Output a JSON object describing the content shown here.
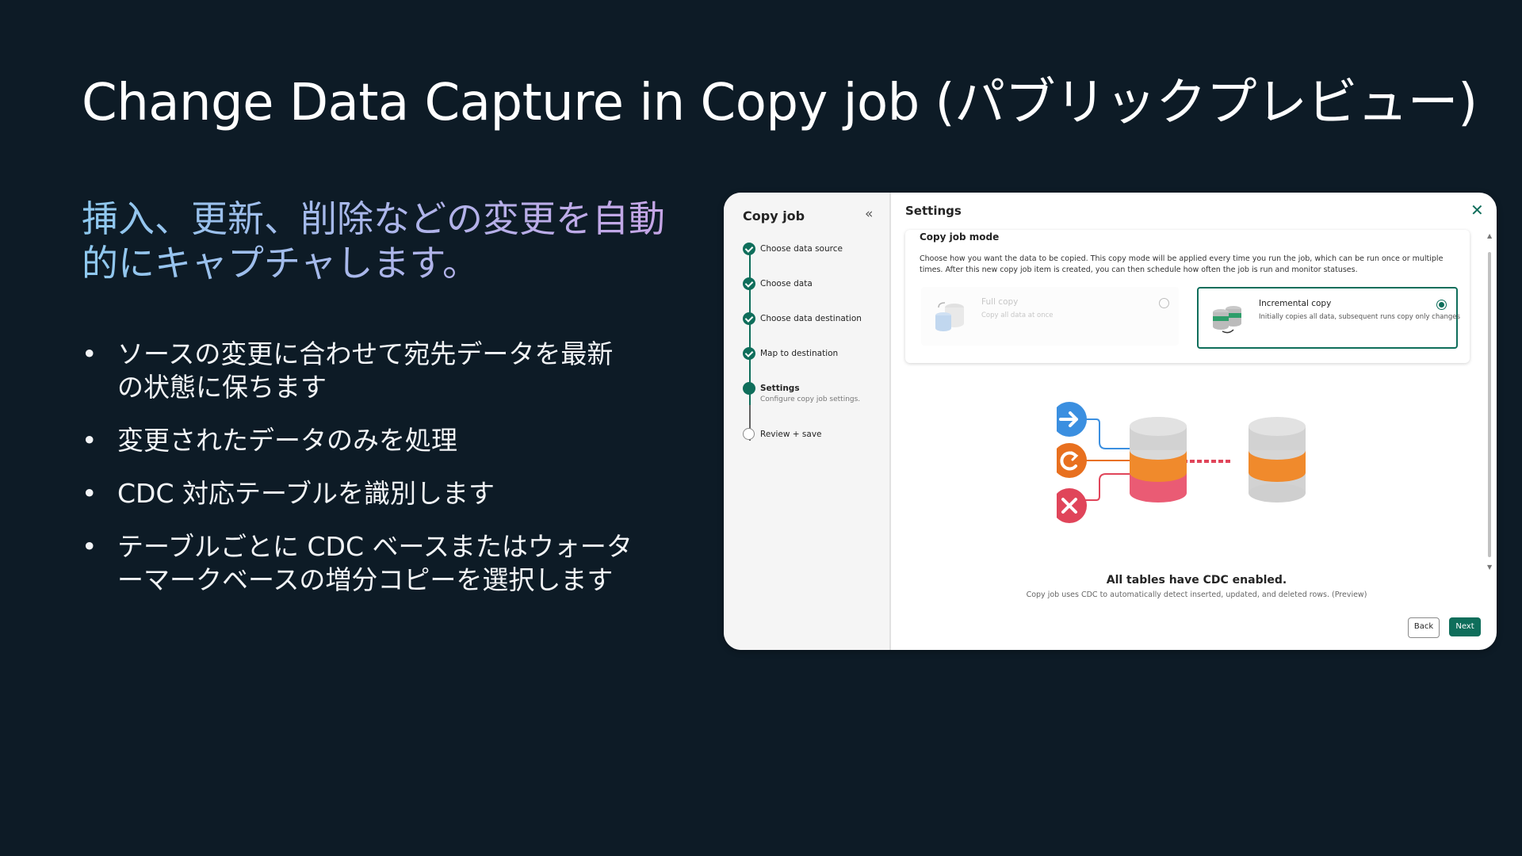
{
  "slide": {
    "title": "Change Data Capture in Copy job (パブリックプレビュー)",
    "headline": "挿入、更新、削除などの変更を自動的にキャプチャします。",
    "bullet_glyph": "•",
    "bullets": [
      "ソースの変更に合わせて宛先データを最新の状態に保ちます",
      "変更されたデータのみを処理",
      "CDC 対応テーブルを識別します",
      "テーブルごとに CDC ベースまたはウォーターマークベースの増分コピーを選択します"
    ]
  },
  "app": {
    "sidebar": {
      "title": "Copy job",
      "collapse": "«",
      "steps": [
        {
          "label": "Choose data source",
          "state": "done"
        },
        {
          "label": "Choose data",
          "state": "done"
        },
        {
          "label": "Choose data destination",
          "state": "done"
        },
        {
          "label": "Map to destination",
          "state": "done"
        },
        {
          "label": "Settings",
          "sub": "Configure copy job settings.",
          "state": "current"
        },
        {
          "label": "Review + save",
          "state": "pending"
        }
      ]
    },
    "main": {
      "title": "Settings",
      "close": "✕",
      "mode": {
        "title": "Copy job mode",
        "description": "Choose how you want the data to be copied. This copy mode will be applied every time you run the job, which can be run once or multiple times. After this new copy job item is created, you can then schedule how often the job is run and monitor statuses.",
        "options": [
          {
            "title": "Full copy",
            "description": "Copy all data at once",
            "selected": false
          },
          {
            "title": "Incremental copy",
            "description": "Initially copies all data, subsequent runs copy only changes",
            "selected": true
          }
        ]
      },
      "cdc_title": "All tables have CDC enabled.",
      "cdc_description": "Copy job uses CDC to automatically detect inserted, updated, and deleted rows. (Preview)",
      "back_label": "Back",
      "next_label": "Next",
      "scroll_up": "▲",
      "scroll_down": "▼"
    }
  },
  "colors": {
    "background": "#0d1b26",
    "accent": "#0f6e5b",
    "insert": "#3b8fe0",
    "update": "#e8701f",
    "delete": "#e0455a"
  },
  "icons": [
    "insert-arrow-icon",
    "update-refresh-icon",
    "delete-x-icon",
    "source-database-icon",
    "destination-database-icon"
  ]
}
